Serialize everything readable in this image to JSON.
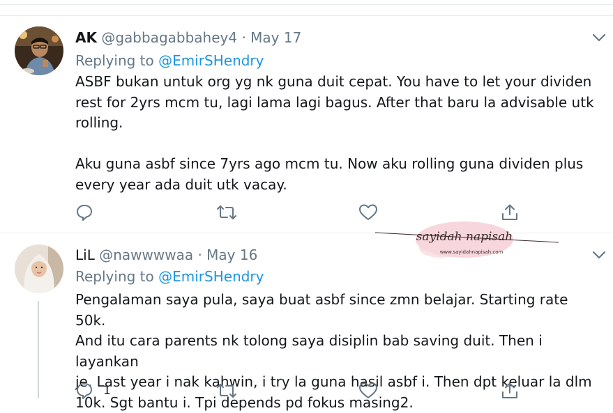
{
  "tweets": [
    {
      "name": "AK",
      "handle": "@gabbagabbahey4",
      "dot": "·",
      "date": "May 17",
      "replying_prefix": "Replying to ",
      "replying_to": "@EmirSHendry",
      "lines": [
        "ASBF bukan untuk org yg nk guna duit cepat. You have to let your dividen",
        "rest for 2yrs mcm tu, lagi lama lagi bagus. After that baru la advisable utk",
        "rolling.",
        "",
        "Aku guna asbf since 7yrs ago mcm tu. Now aku rolling guna dividen plus",
        "every year ada duit utk vacay."
      ],
      "reply_count": "",
      "retweet_count": "",
      "like_count": ""
    },
    {
      "name": "ᒪiᒪ",
      "handle": "@nawwwwaa",
      "dot": "·",
      "date": "May 16",
      "replying_prefix": "Replying to ",
      "replying_to": "@EmirSHendry",
      "lines": [
        "Pengalaman saya pula, saya buat asbf since zmn belajar. Starting rate 50k.",
        "And itu cara parents nk tolong saya disiplin bab saving duit. Then i layankan",
        "je. Last year i nak kahwin, i try la guna hasil asbf i. Then dpt keluar la dlm",
        "10k. Sgt bantu i. Tpi depends pd fokus masing2."
      ],
      "reply_count": "1",
      "retweet_count": "",
      "like_count": ""
    }
  ],
  "watermark": {
    "title": "sayidah napisah",
    "url": "www.sayidahnapisah.com"
  },
  "icons": [
    "chevron-down-icon",
    "reply-icon",
    "retweet-icon",
    "like-icon",
    "share-icon"
  ],
  "colors": {
    "link": "#1b95e0",
    "muted": "#657786",
    "divider": "#e6ecf0"
  }
}
